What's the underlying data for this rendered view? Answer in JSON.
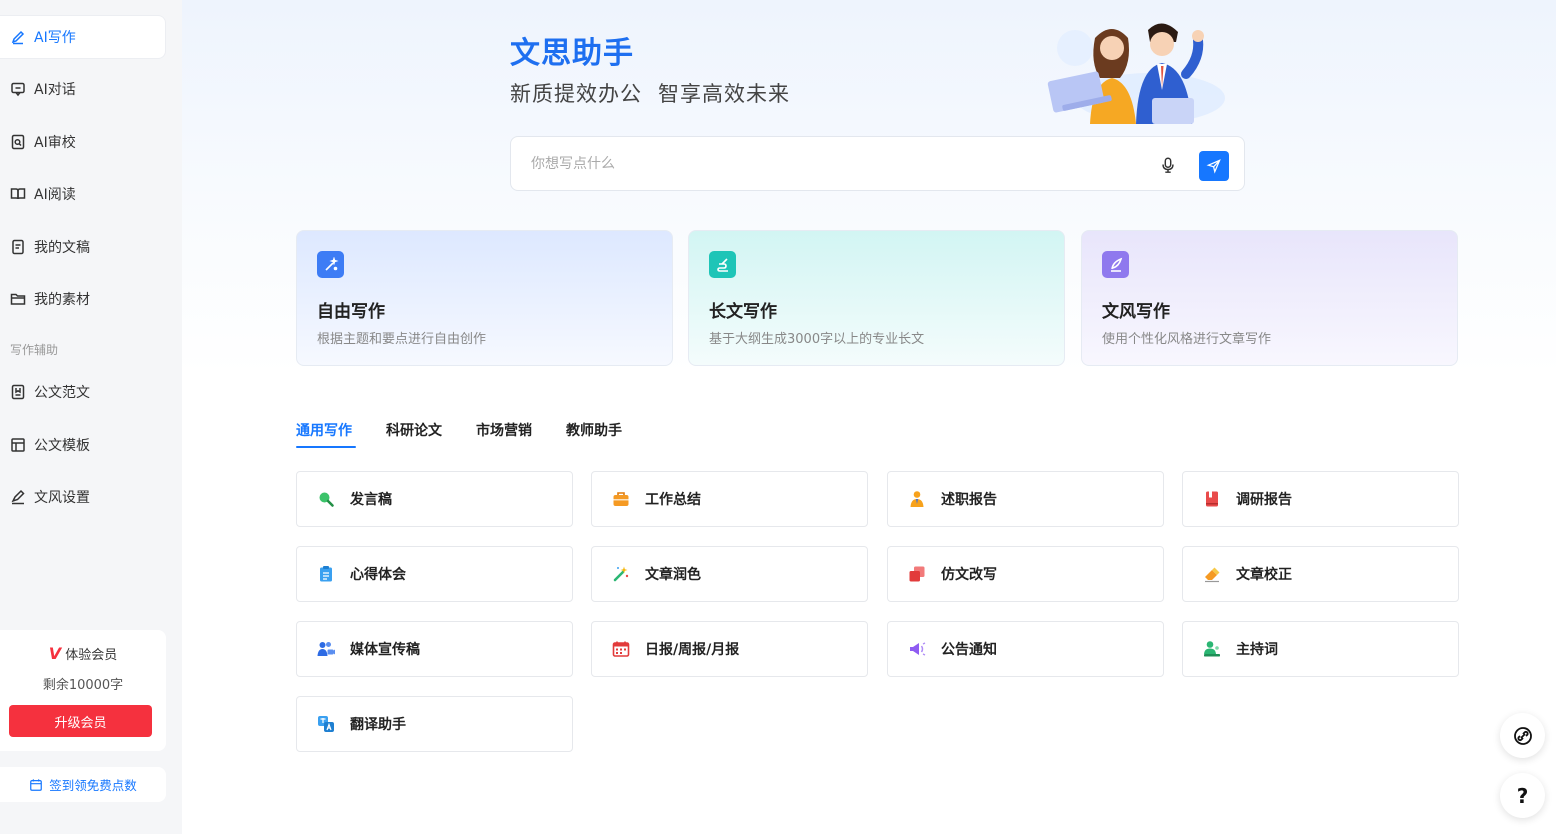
{
  "sidebar": {
    "items": [
      {
        "label": "AI写作",
        "icon": "pen-icon"
      },
      {
        "label": "AI对话",
        "icon": "chat-icon"
      },
      {
        "label": "AI审校",
        "icon": "proofread-icon"
      },
      {
        "label": "AI阅读",
        "icon": "book-icon"
      },
      {
        "label": "我的文稿",
        "icon": "document-icon"
      },
      {
        "label": "我的素材",
        "icon": "folder-icon"
      },
      {
        "label": "公文范文",
        "icon": "bookmark-doc-icon"
      },
      {
        "label": "公文模板",
        "icon": "template-icon"
      },
      {
        "label": "文风设置",
        "icon": "brush-icon"
      }
    ],
    "section_label": "写作辅助",
    "member": {
      "title": "体验会员",
      "remaining": "剩余10000字",
      "upgrade_label": "升级会员"
    },
    "signin_label": "签到领免费点数"
  },
  "hero": {
    "title": "文思助手",
    "subtitle_1": "新质提效办公",
    "subtitle_2": "智享高效未来"
  },
  "search": {
    "placeholder": "你想写点什么",
    "value": ""
  },
  "feature_cards": [
    {
      "title": "自由写作",
      "desc": "根据主题和要点进行自由创作",
      "color": "#3d7cf5"
    },
    {
      "title": "长文写作",
      "desc": "基于大纲生成3000字以上的专业长文",
      "color": "#1ec5b7"
    },
    {
      "title": "文风写作",
      "desc": "使用个性化风格进行文章写作",
      "color": "#8f79ee"
    }
  ],
  "tabs": [
    "通用写作",
    "科研论文",
    "市场营销",
    "教师助手"
  ],
  "templates": [
    {
      "label": "发言稿",
      "icon": "magnifier-icon"
    },
    {
      "label": "工作总结",
      "icon": "briefcase-icon"
    },
    {
      "label": "述职报告",
      "icon": "person-tie-icon"
    },
    {
      "label": "调研报告",
      "icon": "red-book-icon"
    },
    {
      "label": "心得体会",
      "icon": "clipboard-icon"
    },
    {
      "label": "文章润色",
      "icon": "magic-wand-icon"
    },
    {
      "label": "仿文改写",
      "icon": "copy-pages-icon"
    },
    {
      "label": "文章校正",
      "icon": "eraser-icon"
    },
    {
      "label": "媒体宣传稿",
      "icon": "media-people-icon"
    },
    {
      "label": "日报/周报/月报",
      "icon": "calendar-icon"
    },
    {
      "label": "公告通知",
      "icon": "megaphone-icon"
    },
    {
      "label": "主持词",
      "icon": "host-icon"
    },
    {
      "label": "翻译助手",
      "icon": "translate-icon"
    }
  ],
  "float": {
    "help_label": "?"
  },
  "colors": {
    "accent": "#1677ff",
    "danger": "#f5313e"
  }
}
